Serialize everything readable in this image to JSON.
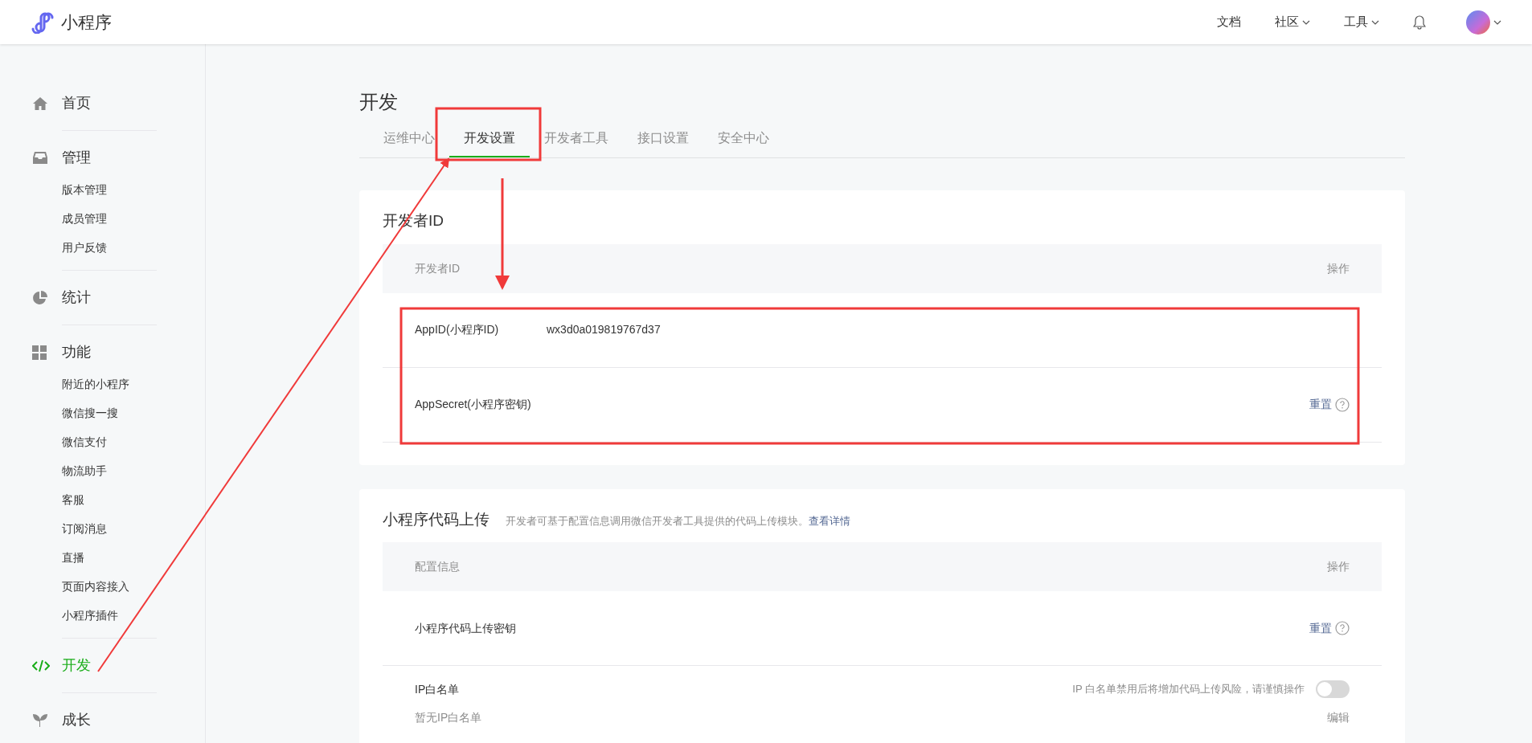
{
  "header": {
    "logo_text": "小程序",
    "nav": [
      {
        "label": "文档",
        "dropdown": false
      },
      {
        "label": "社区",
        "dropdown": true
      },
      {
        "label": "工具",
        "dropdown": true
      }
    ]
  },
  "sidebar": {
    "items": [
      {
        "label": "首页",
        "selected": false
      },
      {
        "label": "管理",
        "selected": false,
        "children": [
          {
            "label": "版本管理"
          },
          {
            "label": "成员管理"
          },
          {
            "label": "用户反馈"
          }
        ]
      },
      {
        "label": "统计",
        "selected": false
      },
      {
        "label": "功能",
        "selected": false,
        "children": [
          {
            "label": "附近的小程序"
          },
          {
            "label": "微信搜一搜"
          },
          {
            "label": "微信支付"
          },
          {
            "label": "物流助手"
          },
          {
            "label": "客服"
          },
          {
            "label": "订阅消息"
          },
          {
            "label": "直播"
          },
          {
            "label": "页面内容接入"
          },
          {
            "label": "小程序插件"
          }
        ]
      },
      {
        "label": "开发",
        "selected": true
      },
      {
        "label": "成长",
        "selected": false
      }
    ]
  },
  "page": {
    "title": "开发",
    "tabs": [
      {
        "label": "运维中心",
        "selected": false
      },
      {
        "label": "开发设置",
        "selected": true
      },
      {
        "label": "开发者工具",
        "selected": false
      },
      {
        "label": "接口设置",
        "selected": false
      },
      {
        "label": "安全中心",
        "selected": false
      }
    ]
  },
  "developer_id": {
    "title": "开发者ID",
    "columns": [
      "开发者ID",
      "操作"
    ],
    "rows": [
      {
        "label": "AppID(小程序ID)",
        "value": "wx3d0a019819767d37"
      },
      {
        "label": "AppSecret(小程序密钥)",
        "action": "重置"
      }
    ]
  },
  "code_upload": {
    "title": "小程序代码上传",
    "description": "开发者可基于配置信息调用微信开发者工具提供的代码上传模块。",
    "link": "查看详情",
    "columns": [
      "配置信息",
      "操作"
    ],
    "key_row": {
      "label": "小程序代码上传密钥",
      "action": "重置"
    },
    "ip_whitelist": {
      "label": "IP白名单",
      "note": "IP 白名单禁用后将增加代码上传风险，请谨慎操作",
      "on": false,
      "empty_text": "暂无IP白名单",
      "action": "编辑"
    }
  }
}
